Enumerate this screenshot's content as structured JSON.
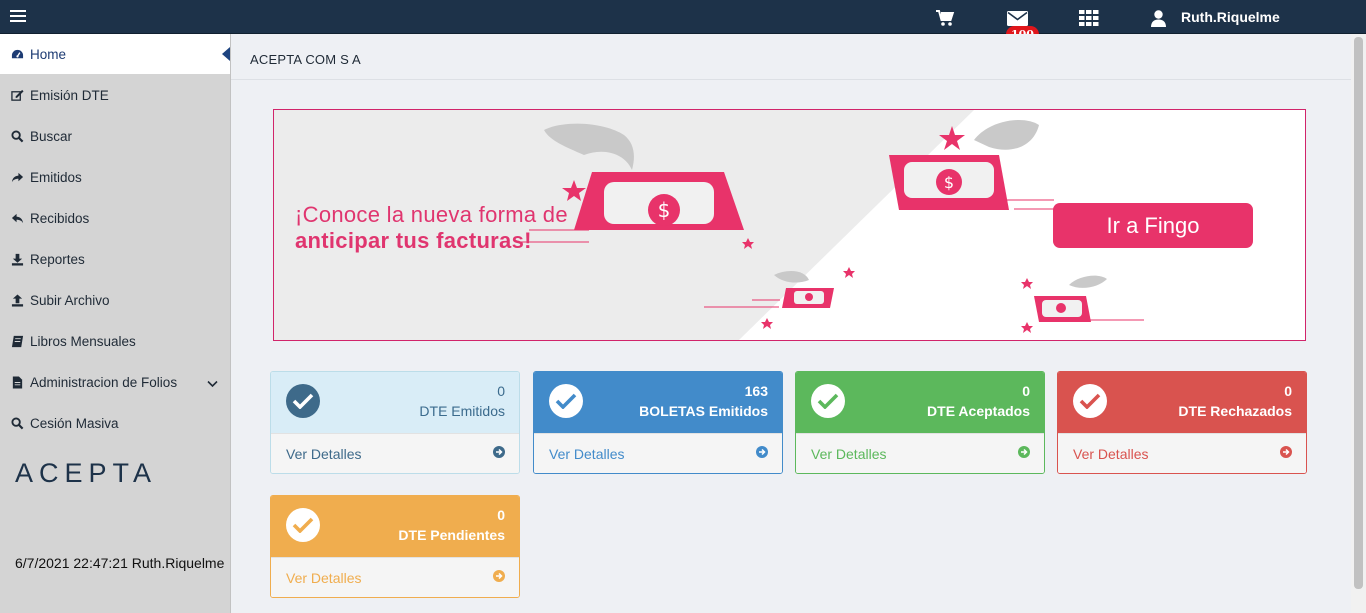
{
  "topbar": {
    "user": "Ruth.Riquelme",
    "mail_badge": "100",
    "icons": [
      "menu-icon",
      "cart-icon",
      "mail-icon",
      "apps-grid-icon",
      "user-icon"
    ]
  },
  "sidebar": {
    "items": [
      {
        "label": "Home",
        "icon": "dashboard-icon"
      },
      {
        "label": "Emisión DTE",
        "icon": "edit-icon"
      },
      {
        "label": "Buscar",
        "icon": "search-icon"
      },
      {
        "label": "Emitidos",
        "icon": "share-icon"
      },
      {
        "label": "Recibidos",
        "icon": "reply-icon"
      },
      {
        "label": "Reportes",
        "icon": "download-icon"
      },
      {
        "label": "Subir Archivo",
        "icon": "upload-icon"
      },
      {
        "label": "Libros Mensuales",
        "icon": "book-icon"
      },
      {
        "label": "Administracion de Folios",
        "icon": "file-icon"
      },
      {
        "label": "Cesión Masiva",
        "icon": "search-icon"
      }
    ],
    "logo": "ACEPTA",
    "footer": "6/7/2021 22:47:21 Ruth.Riquelme"
  },
  "main": {
    "company": "ACEPTA COM S A",
    "banner": {
      "line1": "¡Conoce la nueva forma de",
      "line2": "anticipar tus facturas!",
      "button": "Ir a Fingo"
    },
    "cards": [
      {
        "count": "0",
        "label": "DTE Emitidos",
        "link": "Ver Detalles",
        "color": "#3e6a8a",
        "bg": "#d9edf7"
      },
      {
        "count": "163",
        "label": "BOLETAS Emitidos",
        "link": "Ver Detalles",
        "color": "#428bca",
        "bg": "#428bca"
      },
      {
        "count": "0",
        "label": "DTE Aceptados",
        "link": "Ver Detalles",
        "color": "#5cb85c",
        "bg": "#5cb85c"
      },
      {
        "count": "0",
        "label": "DTE Rechazados",
        "link": "Ver Detalles",
        "color": "#d9534f",
        "bg": "#d9534f"
      },
      {
        "count": "0",
        "label": "DTE Pendientes",
        "link": "Ver Detalles",
        "color": "#f0ad4e",
        "bg": "#f0ad4e"
      }
    ]
  }
}
